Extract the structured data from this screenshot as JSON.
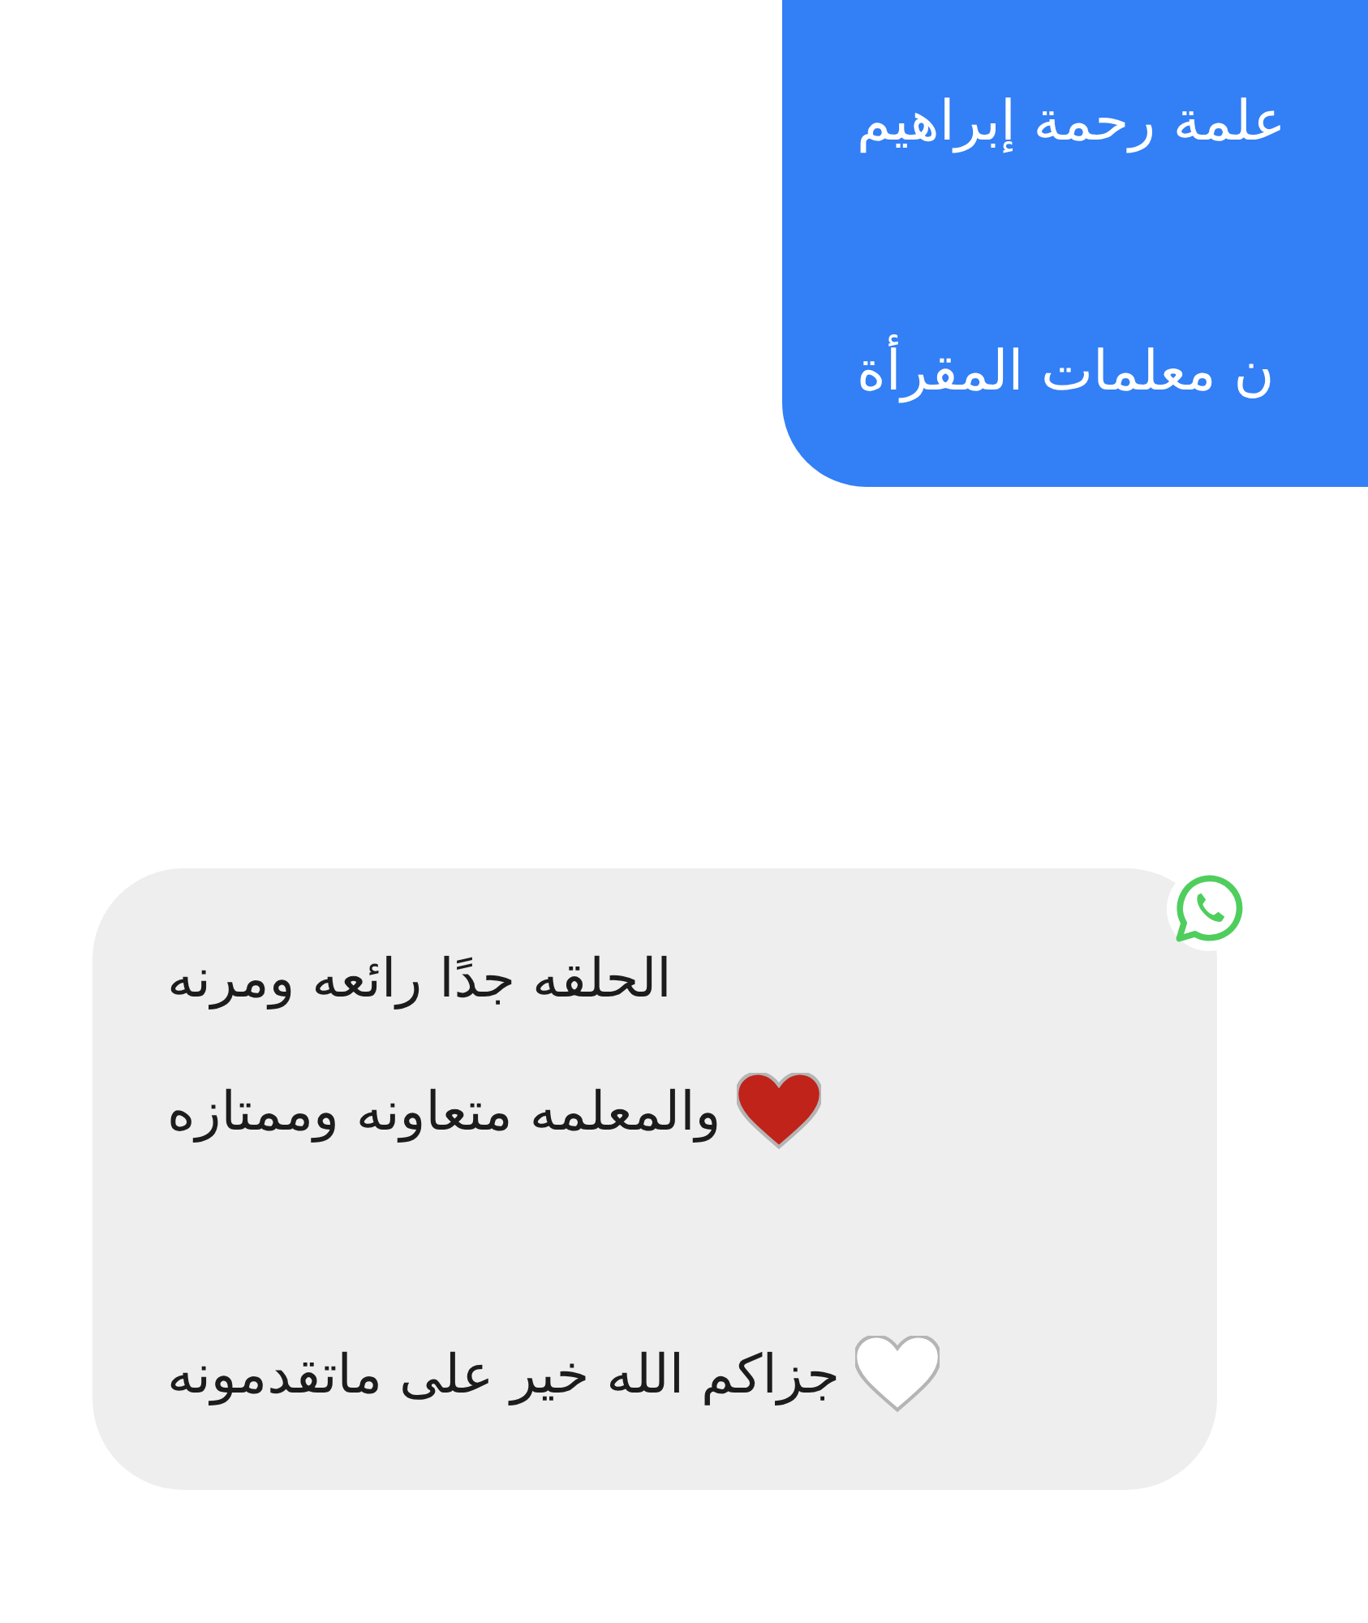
{
  "messages": [
    {
      "kind": "sent",
      "lines": [
        {
          "kind": "text",
          "text": "علمة رحمة إبراهيم"
        },
        {
          "kind": "gap"
        },
        {
          "kind": "text",
          "text": "ن معلمات المقرأة"
        }
      ]
    },
    {
      "kind": "received",
      "lines": [
        {
          "kind": "text",
          "text": "الحلقه جدًا رائعه ومرنه"
        },
        {
          "kind": "text",
          "text": "والمعلمه متعاونه وممتازه",
          "color": "#c0231a"
        },
        {
          "kind": "gap"
        },
        {
          "kind": "text",
          "text": "جزاكم الله خير على ماتقدمونه",
          "color": "#ffffff"
        }
      ]
    }
  ]
}
